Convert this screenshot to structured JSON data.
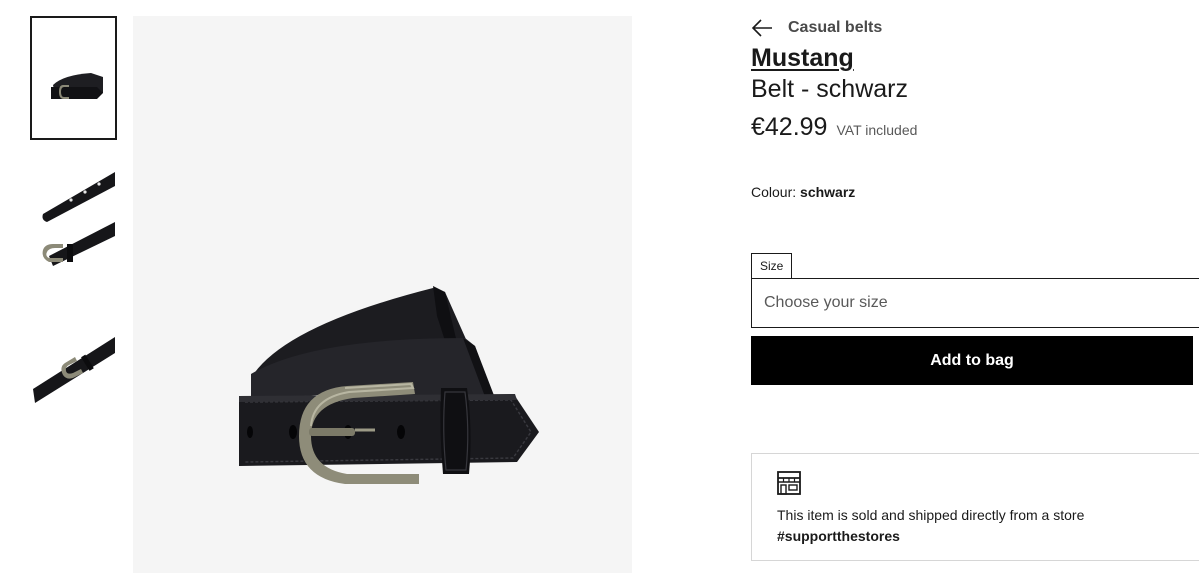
{
  "gallery": {
    "thumbnails": [
      {
        "icon": "belt-coiled-thumbnail",
        "active": true
      },
      {
        "icon": "belt-straps-thumbnail",
        "active": false
      },
      {
        "icon": "belt-buckle-thumbnail",
        "active": false
      }
    ],
    "main_image": {
      "icon": "coiled-black-belt-with-antique-buckle"
    }
  },
  "breadcrumb": {
    "icon": "back-arrow-icon",
    "label": "Casual belts"
  },
  "product": {
    "brand": "Mustang",
    "name": "Belt - schwarz",
    "price": "€42.99",
    "vat_note": "VAT included",
    "colour_label": "Colour:",
    "colour_value": "schwarz"
  },
  "size": {
    "label": "Size",
    "placeholder": "Choose your size"
  },
  "actions": {
    "add_to_bag": "Add to bag"
  },
  "store_notice": {
    "icon": "store-icon",
    "text": "This item is sold and shipped directly from a store",
    "tag": "#supportthestores"
  },
  "colors": {
    "primary": "#000000",
    "text": "#1a1a1a",
    "muted": "#595959",
    "image_bg": "#f5f5f5",
    "border": "#d6d6d6"
  }
}
